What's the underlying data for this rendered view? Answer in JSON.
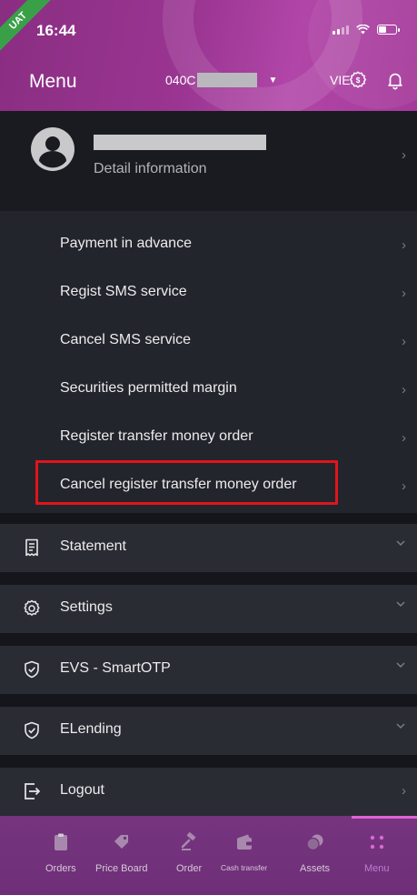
{
  "status_bar": {
    "badge": "UAT",
    "time": "16:44"
  },
  "header": {
    "title": "Menu",
    "account_prefix": "040C",
    "language": "VIE"
  },
  "profile": {
    "subtitle": "Detail information"
  },
  "submenu": [
    {
      "label": "Payment in advance"
    },
    {
      "label": "Regist SMS service"
    },
    {
      "label": "Cancel SMS service"
    },
    {
      "label": "Securities permitted margin"
    },
    {
      "label": "Register transfer money order"
    },
    {
      "label": "Cancel register transfer money order",
      "highlighted": true
    }
  ],
  "sections": [
    {
      "label": "Statement",
      "icon": "receipt-icon",
      "expand": "down"
    },
    {
      "label": "Settings",
      "icon": "gear-icon",
      "expand": "down"
    },
    {
      "label": "EVS - SmartOTP",
      "icon": "shield-check-icon",
      "expand": "down"
    },
    {
      "label": "ELending",
      "icon": "shield-check-icon",
      "expand": "down"
    },
    {
      "label": "Logout",
      "icon": "logout-icon",
      "expand": "right"
    }
  ],
  "bottom_nav": [
    {
      "label": "Orders",
      "icon": "clipboard-icon"
    },
    {
      "label": "Price Board",
      "icon": "tag-icon"
    },
    {
      "label": "Order",
      "icon": "gavel-icon"
    },
    {
      "label": "Cash transfer",
      "icon": "wallet-icon"
    },
    {
      "label": "Assets",
      "icon": "coins-icon"
    },
    {
      "label": "Menu",
      "icon": "grid-icon",
      "active": true
    }
  ],
  "colors": {
    "header_gradient": "#9a3592",
    "highlight_border": "#e1141c",
    "active_tab": "#c07bd0"
  }
}
